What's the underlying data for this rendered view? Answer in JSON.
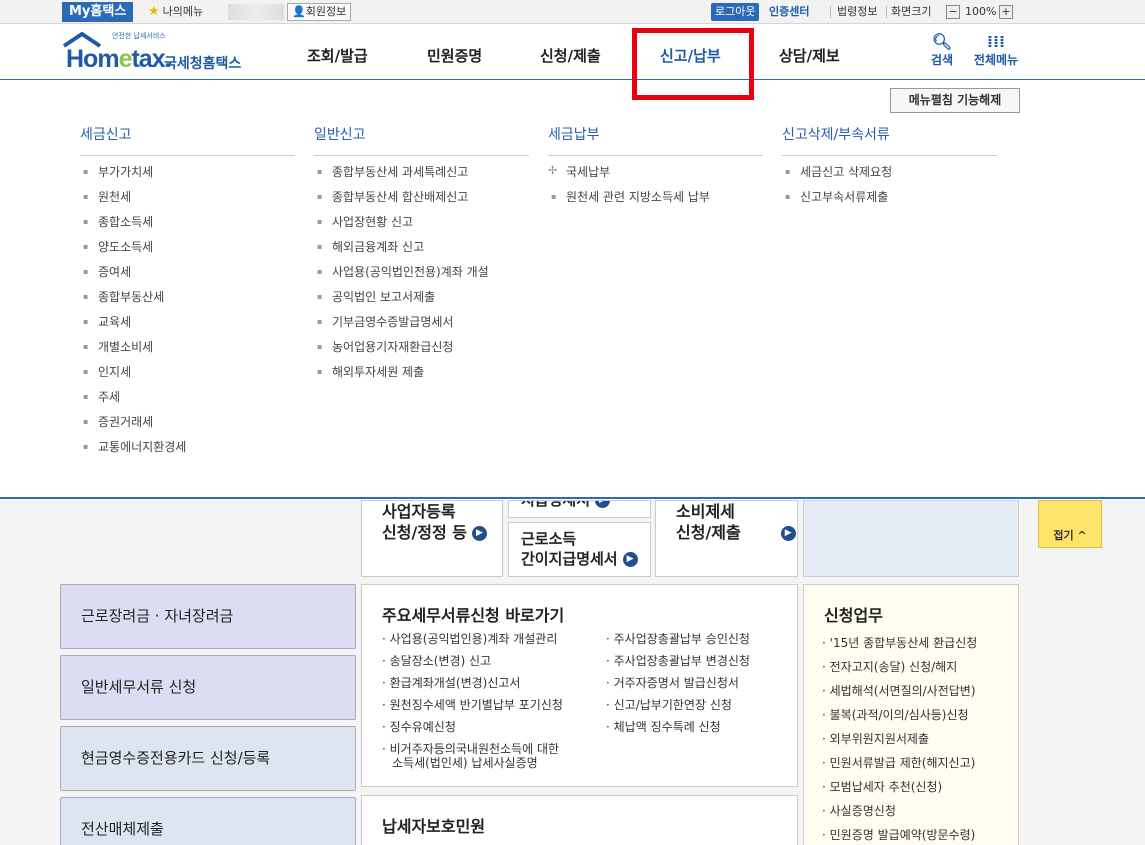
{
  "topbar": {
    "my_hometax": "My홈택스",
    "my_menu": "나의메뉴",
    "member_info": "회원정보",
    "logout": "로그아웃",
    "cert_center": "인증센터",
    "law_info": "법령정보",
    "screen_size": "화면크기",
    "zoom_minus": "−",
    "zoom_value": "100%",
    "zoom_plus": "+"
  },
  "header": {
    "logo_small": "안전한 납세서비스",
    "logo_brand_1": "Hom",
    "logo_brand_e": "e",
    "logo_brand_2": "tax.",
    "logo_kr": "국세청홈택스",
    "nav": [
      "조회/발급",
      "민원증명",
      "신청/제출",
      "신고/납부",
      "상담/제보"
    ],
    "search": "검색",
    "all_menu": "전체메뉴"
  },
  "dropdown": {
    "menu_fold_label": "메뉴펼침 기능해제",
    "columns": [
      {
        "title": "세금신고",
        "items": [
          "부가가치세",
          "원천세",
          "종합소득세",
          "양도소득세",
          "증여세",
          "종합부동산세",
          "교육세",
          "개별소비세",
          "인지세",
          "주세",
          "증권거래세",
          "교통에너지환경세"
        ]
      },
      {
        "title": "일반신고",
        "items": [
          "종합부동산세 과세특례신고",
          "종합부동산세 합산배제신고",
          "사업장현황 신고",
          "해외금융계좌 신고",
          "사업용(공익법인전용)계좌 개설",
          "공익법인 보고서제출",
          "기부금영수증발급명세서",
          "농어업용기자재환급신청",
          "해외투자세원 제출"
        ]
      },
      {
        "title": "세금납부",
        "items": [
          "국세납부",
          "원천세 관련 지방소득세 납부"
        ]
      },
      {
        "title": "신고삭제/부속서류",
        "items": [
          "세금신고 삭제요청",
          "신고부속서류제출"
        ]
      }
    ]
  },
  "lower": {
    "biz_register_1": "사업자등록",
    "biz_register_2": "신청/정정 등",
    "partial_label": "지급명세서",
    "earned_income_1": "근로소득",
    "earned_income_2": "간이지급명세서",
    "excise_1": "소비제세",
    "excise_2": "신청/제출",
    "fold": "접기 ^",
    "left_items": [
      "근로장려금 · 자녀장려금",
      "일반세무서류 신청",
      "현금영수증전용카드 신청/등록",
      "전산매체제출"
    ],
    "main_docs_title": "주요세무서류신청 바로가기",
    "main_docs_left": [
      "사업용(공익법인용)계좌 개설관리",
      "송달장소(변경) 신고",
      "환급계좌개설(변경)신고서",
      "원천징수세액 반기별납부 포기신청",
      "징수유예신청",
      "비거주자등의국내원천소득에 대한",
      "소득세(법인세) 납세사실증명"
    ],
    "main_docs_right": [
      "주사업장총괄납부 승인신청",
      "주사업장총괄납부 변경신청",
      "거주자증명서 발급신청서",
      "신고/납부기한연장 신청",
      "체납액 징수특례 신청"
    ],
    "taxpayer_title": "납세자보호민원",
    "apply_title": "신청업무",
    "apply_items": [
      "'15년 종합부동산세 환급신청",
      "전자고지(송달) 신청/해지",
      "세법해석(서면질의/사전답변)",
      "불복(과적/이의/심사등)신청",
      "외부위원지원서제출",
      "민원서류발급 제한(해지신고)",
      "모범납세자 추천(신청)",
      "사실증명신청",
      "민원증명 발급예약(방문수령)"
    ]
  },
  "colors": {
    "accent": "#2a6ab8",
    "highlight": "#e60012"
  }
}
